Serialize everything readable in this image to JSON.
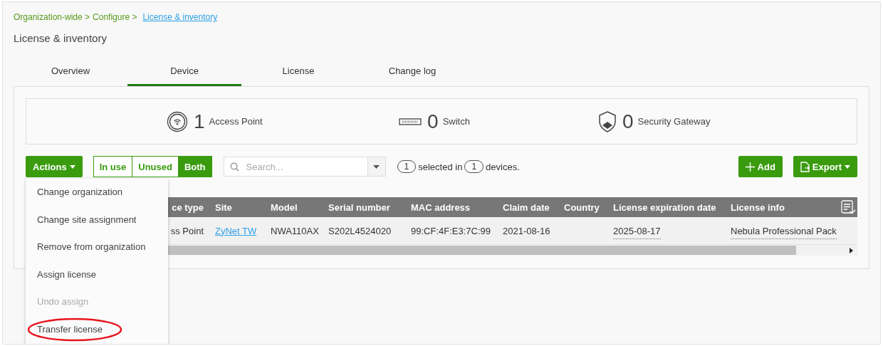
{
  "breadcrumb": {
    "items": [
      "Organization-wide >",
      "Configure >"
    ],
    "current": "License & inventory"
  },
  "page_title": "License & inventory",
  "tabs": [
    {
      "label": "Overview",
      "selected": false
    },
    {
      "label": "Device",
      "selected": true
    },
    {
      "label": "License",
      "selected": false
    },
    {
      "label": "Change log",
      "selected": false
    }
  ],
  "summary": [
    {
      "kind": "ap",
      "count": "1",
      "label": "Access Point"
    },
    {
      "kind": "switch",
      "count": "0",
      "label": "Switch"
    },
    {
      "kind": "gateway",
      "count": "0",
      "label": "Security Gateway"
    }
  ],
  "toolbar": {
    "actions": "Actions",
    "filters": [
      {
        "label": "In use",
        "selected": false
      },
      {
        "label": "Unused",
        "selected": false
      },
      {
        "label": "Both",
        "selected": true
      }
    ],
    "search": {
      "placeholder": "Search..."
    },
    "selection": [
      "1",
      "selected in",
      "1",
      "devices."
    ],
    "add": "Add",
    "export": "Export"
  },
  "table": {
    "columns": [
      "ce type",
      "Site",
      "Model",
      "Serial number",
      "MAC address",
      "Claim date",
      "Country",
      "License expiration date",
      "License info"
    ],
    "rows": [
      {
        "cells": [
          "ss Point",
          "ZyNet TW",
          "NWA110AX",
          "S202L4524020",
          "99:CF:4F:E3:7C:99",
          "2021-08-16",
          "",
          "2025-08-17",
          "Nebula Professional Pack"
        ]
      }
    ]
  },
  "actions_menu": [
    {
      "label": "Change organization",
      "disabled": false,
      "highlighted": false
    },
    {
      "label": "Change site assignment",
      "disabled": false,
      "highlighted": false
    },
    {
      "label": "Remove from organization",
      "disabled": false,
      "highlighted": false
    },
    {
      "label": "Assign license",
      "disabled": false,
      "highlighted": false
    },
    {
      "label": "Undo assign",
      "disabled": true,
      "highlighted": false
    },
    {
      "label": "Transfer license",
      "disabled": false,
      "highlighted": true
    }
  ]
}
